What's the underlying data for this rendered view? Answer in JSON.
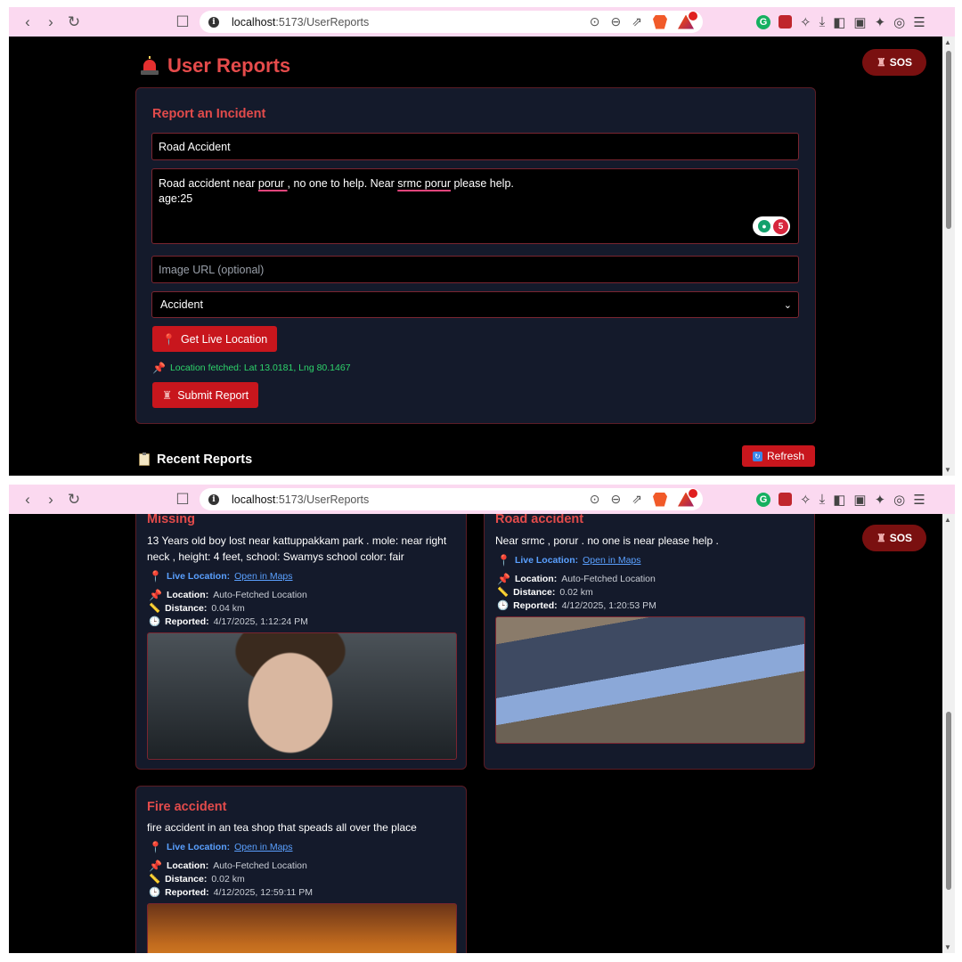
{
  "browser": {
    "url_host": "localhost",
    "url_path": ":5173/UserReports",
    "extension_badge": "5"
  },
  "sos_label": "SOS",
  "page_title": "User Reports",
  "form": {
    "title": "Report an Incident",
    "title_value": "Road Accident",
    "description_parts": [
      "Road accident near ",
      "porur ",
      ", no one to help. Near ",
      "srmc porur",
      " please help."
    ],
    "description_line2": "age:25",
    "grammarly_count": "5",
    "image_url_placeholder": "Image URL (optional)",
    "category_selected": "Accident",
    "get_location_label": "Get Live Location",
    "location_fetched_text": "Location fetched: Lat 13.0181, Lng 80.1467",
    "submit_label": "Submit Report"
  },
  "recent": {
    "title": "Recent Reports",
    "refresh_label": "Refresh"
  },
  "labels": {
    "live_location": "Live Location:",
    "open_in_maps": "Open in Maps",
    "location": "Location:",
    "distance": "Distance:",
    "reported": "Reported:"
  },
  "reports": [
    {
      "title": "Missing",
      "description": "13 Years old boy lost near kattuppakkam park . mole: near right neck , height: 4 feet, school: Swamys school color: fair",
      "location": "Auto-Fetched Location",
      "distance": "0.04 km",
      "reported": "4/17/2025, 1:12:24 PM"
    },
    {
      "title": "Road accident",
      "description": "Near srmc , porur . no one is near please help .",
      "location": "Auto-Fetched Location",
      "distance": "0.02 km",
      "reported": "4/12/2025, 1:20:53 PM"
    },
    {
      "title": "Fire accident",
      "description": "fire accident in an tea shop that speads all over the place",
      "location": "Auto-Fetched Location",
      "distance": "0.02 km",
      "reported": "4/12/2025, 12:59:11 PM"
    }
  ]
}
